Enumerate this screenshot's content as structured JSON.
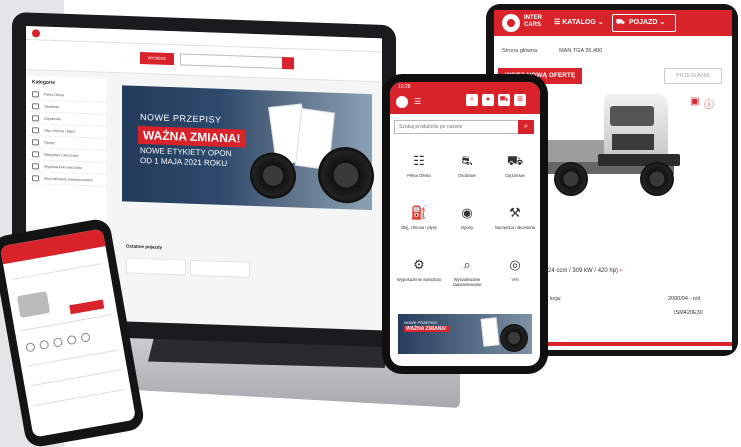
{
  "laptop": {
    "vehicle_button": "WYBIERZ POJAZD",
    "sidebar_title": "Kategorie",
    "sidebar_items": [
      "Pełna Oferta",
      "Osobowe",
      "Ciężarowe",
      "Olej, chemia i płyny",
      "Opony",
      "Narzędzia i akcesoria",
      "Wyposażenie warsztatu",
      "Wyszukiwanie zaawansowane"
    ],
    "banner": {
      "line1": "NOWE PRZEPISY",
      "line2": "WAŻNA ZMIANA!",
      "line3": "NOWE ETYKIETY OPON",
      "line4": "OD 1 MAJA 2021 ROKU"
    },
    "section_title": "Ostatnie pojazdy"
  },
  "tablet": {
    "logo_line1": "INTER",
    "logo_line2": "CARS",
    "menu_label": "KATALOG",
    "vehicle_label": "POJAZD",
    "breadcrumb_home": "Strona główna",
    "breadcrumb_vehicle": "MAN TGA 26.400",
    "order_button": "WORZ NOWĄ OFERTĘ",
    "clear_button": "PRZESŁANIE",
    "engine_desc": "(10824 ccm / 309 kW / 420 hp)",
    "production_label": "kcja:",
    "production_value": "2000/04 - n/d",
    "engine_code": "ISM420E30"
  },
  "phone": {
    "time": "10:28",
    "search_placeholder": "Szukaj produktów po nazwie",
    "grid": [
      {
        "label": "Pełna Oferta",
        "icon": "list-icon"
      },
      {
        "label": "Osobowe",
        "icon": "car-icon"
      },
      {
        "label": "Ciężarowe",
        "icon": "truck-icon"
      },
      {
        "label": "Olej, chemia i płyny",
        "icon": "oil-can-icon"
      },
      {
        "label": "Opony",
        "icon": "tyre-icon"
      },
      {
        "label": "Narzędzia i akcesoria",
        "icon": "tools-icon"
      },
      {
        "label": "Wyposażenie warsztatu",
        "icon": "workshop-icon"
      },
      {
        "label": "Wyszukiwanie zaawansowane",
        "icon": "search-icon"
      },
      {
        "label": "VIN",
        "icon": "vin-icon"
      }
    ],
    "banner_line1": "NOWE PRZEPISY",
    "banner_line2": "WAŻNA ZMIANA!"
  },
  "colors": {
    "brand_red": "#d8232a",
    "dark": "#141414",
    "banner_blue": "#2e4a6d"
  }
}
